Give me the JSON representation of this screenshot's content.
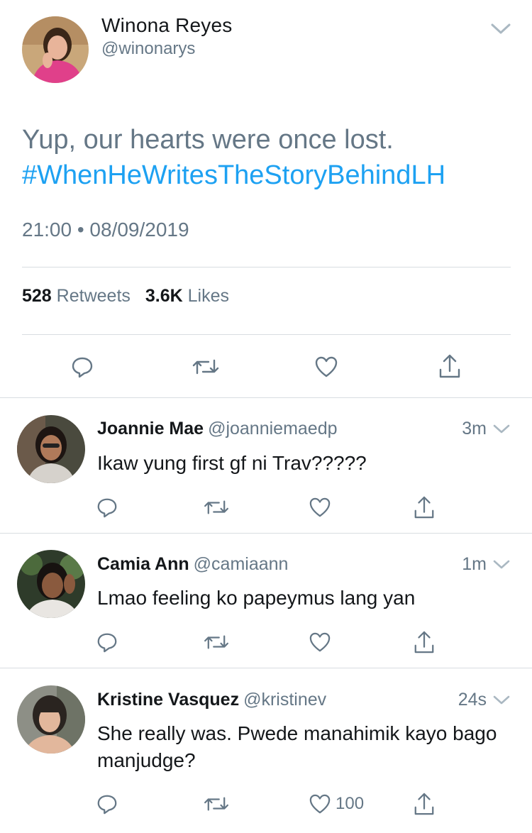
{
  "tweet": {
    "author_name": "Winona Reyes",
    "author_handle": "@winonarys",
    "text": "Yup, our hearts were once lost.",
    "hashtag": "#WhenHeWritesTheStoryBehindLH",
    "timestamp": "21:00 • 08/09/2019",
    "retweet_count": "528",
    "retweet_label": "Retweets",
    "like_count": "3.6K",
    "like_label": "Likes",
    "actions": [
      "reply-icon",
      "retweet-icon",
      "heart-icon",
      "share-icon"
    ]
  },
  "replies": [
    {
      "name": "Joannie Mae",
      "handle": "@joanniemaedp",
      "time": "3m",
      "text": "Ikaw yung first gf ni Trav?????",
      "likes": ""
    },
    {
      "name": "Camia Ann",
      "handle": "@camiaann",
      "time": "1m",
      "text": "Lmao feeling ko papeymus lang yan",
      "likes": ""
    },
    {
      "name": "Kristine Vasquez",
      "handle": "@kristinev",
      "time": "24s",
      "text": "She really was. Pwede manahimik kayo bago manjudge?",
      "likes": "100"
    }
  ],
  "colors": {
    "link": "#1da1f2",
    "secondary_text": "#657786",
    "primary_text": "#14171a",
    "icon": "#657786",
    "divider": "#d8dde1"
  }
}
